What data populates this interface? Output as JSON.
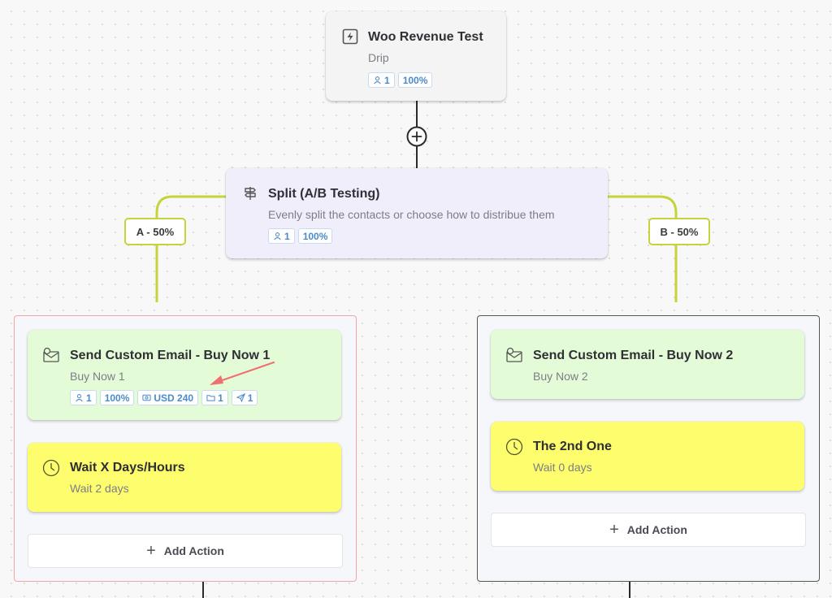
{
  "trigger": {
    "title": "Woo Revenue Test",
    "subtitle": "Drip",
    "icon": "lightning-icon",
    "badges": {
      "contacts": "1",
      "percent": "100%"
    }
  },
  "add_step_icon": "plus-circle-icon",
  "split": {
    "title": "Split (A/B Testing)",
    "subtitle": "Evenly split the contacts or choose how to distribue them",
    "icon": "signpost-icon",
    "badges": {
      "contacts": "1",
      "percent": "100%"
    }
  },
  "branches": [
    {
      "label": "A - 50%",
      "actions": [
        {
          "title": "Send Custom Email - Buy Now 1",
          "subtitle": "Buy Now 1",
          "icon": "email-icon",
          "badges": {
            "contacts": "1",
            "percent": "100%",
            "revenue": "USD 240",
            "folder": "1",
            "sent": "1"
          }
        },
        {
          "title": "Wait X Days/Hours",
          "subtitle": "Wait 2 days",
          "icon": "clock-icon"
        }
      ],
      "add_action_label": "Add Action"
    },
    {
      "label": "B - 50%",
      "actions": [
        {
          "title": "Send Custom Email - Buy Now 2",
          "subtitle": "Buy Now 2",
          "icon": "email-icon"
        },
        {
          "title": "The 2nd One",
          "subtitle": "Wait 0 days",
          "icon": "clock-icon"
        }
      ],
      "add_action_label": "Add Action"
    }
  ],
  "colors": {
    "branch_line": "#c6d43a",
    "email_card": "#e4fbd8",
    "wait_card": "#fdfd6e",
    "split_card": "#f0eefb",
    "trigger_card": "#f4f4f4",
    "badge_text": "#4a8bc9",
    "annotation_arrow": "#f07070"
  }
}
